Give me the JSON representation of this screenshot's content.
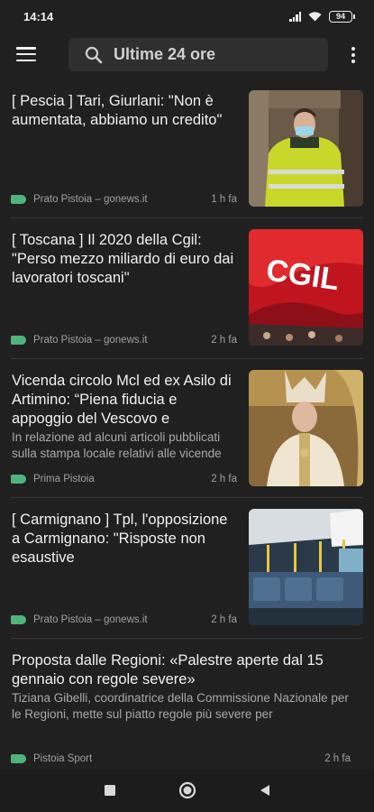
{
  "status": {
    "time": "14:14",
    "battery": "94"
  },
  "toolbar": {
    "search_text": "Ultime 24 ore"
  },
  "articles": [
    {
      "title": "[ Pescia ] Tari, Giurlani: \"Non è aumentata, abbiamo un credito\"",
      "snippet": "",
      "source": "Prato Pistoia – gonews.it",
      "age": "1 h fa",
      "image": "man-in-yellow-jacket"
    },
    {
      "title": "[ Toscana ] Il 2020 della Cgil: \"Perso mezzo miliardo di euro dai lavoratori toscani\"",
      "snippet": "",
      "source": "Prato Pistoia – gonews.it",
      "age": "2 h fa",
      "image": "cgil-flag"
    },
    {
      "title": "Vicenda circolo Mcl ed ex Asilo di Artimino: “Piena fiducia e appoggio del Vescovo e",
      "snippet": "In relazione ad alcuni articoli pubblicati sulla stampa locale relativi alle vicende",
      "source": "Prima Pistoia",
      "age": "2 h fa",
      "image": "bishop"
    },
    {
      "title": "[ Carmignano ] Tpl, l'opposizione a Carmignano: \"Risposte non esaustive",
      "snippet": "",
      "source": "Prato Pistoia – gonews.it",
      "age": "2 h fa",
      "image": "bus-interior"
    },
    {
      "title": "Proposta dalle Regioni: «Palestre aperte dal 15 gennaio con regole severe»",
      "snippet": "Tiziana Gibelli, coordinatrice della Commissione Nazionale per le Regioni, mette sul piatto regole più severe per",
      "source": "Pistoia Sport",
      "age": "2 h fa",
      "image": ""
    }
  ],
  "colors": {
    "background": "#202020",
    "accent": "#4fb37b",
    "search_bg": "#2f2f2f"
  }
}
